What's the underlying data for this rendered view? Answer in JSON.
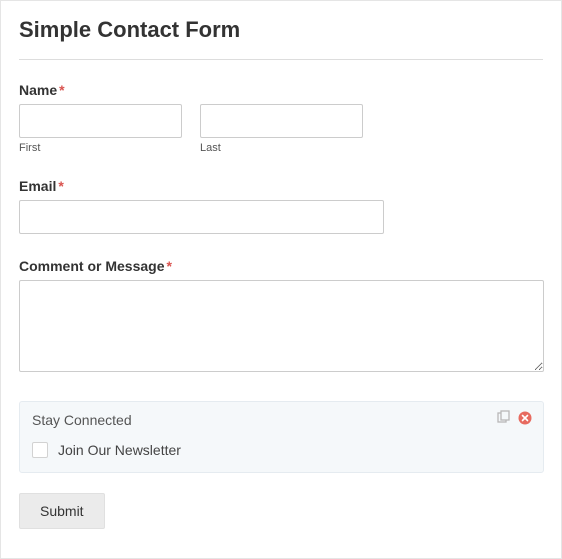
{
  "form": {
    "title": "Simple Contact Form",
    "name": {
      "label": "Name",
      "first_sub": "First",
      "last_sub": "Last"
    },
    "email": {
      "label": "Email"
    },
    "comment": {
      "label": "Comment or Message"
    },
    "required_marker": "*",
    "stay_connected": {
      "title": "Stay Connected",
      "checkbox_label": "Join Our Newsletter"
    },
    "submit_label": "Submit"
  }
}
